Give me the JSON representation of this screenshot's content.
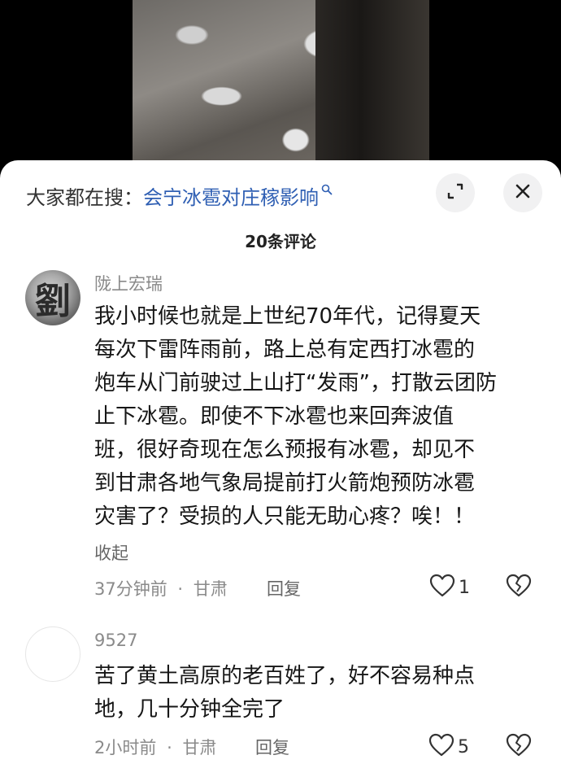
{
  "search": {
    "prefix": "大家都在搜：",
    "query": "会宁冰雹对庄稼影响",
    "search_icon": "search-icon"
  },
  "header": {
    "comment_count": "20条评论",
    "expand_icon": "expand-icon",
    "close_icon": "close-icon"
  },
  "comments": [
    {
      "username": "陇上宏瑞",
      "avatar_text": "劉",
      "lines": [
        "我小时候也就是上世纪70年代，记得夏天",
        "每次下雷阵雨前，路上总有定西打冰雹的",
        "炮车从门前驶过上山打“发雨”，打散云团防",
        "止下冰雹。即使不下冰雹也来回奔波值",
        "班，很好奇现在怎么预报有冰雹，却见不",
        "到甘肃各地气象局提前打火箭炮预防冰雹",
        "灾害了？受损的人只能无助心疼？唉！！"
      ],
      "collapse_label": "收起",
      "time": "37分钟前",
      "separator": "·",
      "location": "甘肃",
      "reply_label": "回复",
      "likes": "1"
    },
    {
      "username": "9527",
      "lines": [
        "苦了黄土高原的老百姓了，好不容易种点",
        "地，几十分钟全完了"
      ],
      "time": "2小时前",
      "separator": "·",
      "location": "甘肃",
      "reply_label": "回复",
      "likes": "5"
    }
  ],
  "colors": {
    "link": "#2f5fb3",
    "muted": "#8a8a8a",
    "text": "#161616",
    "sheet": "#ffffff"
  }
}
